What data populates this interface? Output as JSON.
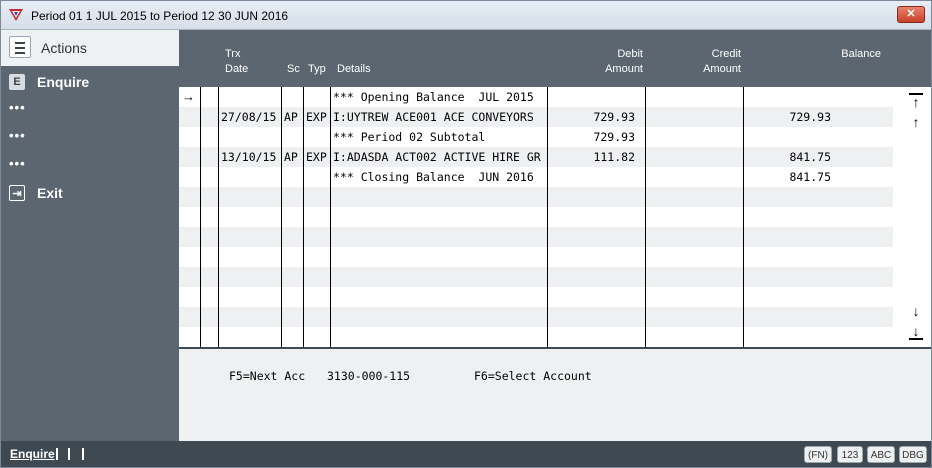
{
  "window": {
    "title": "Period 01 1 JUL 2015  to  Period 12 30 JUN 2016",
    "close_label": "✕"
  },
  "sidebar": {
    "header_label": "Actions",
    "items": [
      {
        "icon": "E",
        "label": "Enquire"
      },
      {
        "dots": "•••"
      },
      {
        "dots": "•••"
      },
      {
        "dots": "•••"
      },
      {
        "icon": "⇥",
        "label": "Exit"
      }
    ]
  },
  "grid": {
    "headers": {
      "trx_date_1": "Trx",
      "trx_date_2": "Date",
      "sc": "Sc",
      "typ": "Typ",
      "details": "Details",
      "debit_1": "Debit",
      "debit_2": "Amount",
      "credit_1": "Credit",
      "credit_2": "Amount",
      "balance": "Balance"
    },
    "pointer": "→",
    "rows": [
      {
        "date": "",
        "sc": "",
        "typ": "",
        "details": "*** Opening Balance  JUL 2015",
        "debit": "",
        "credit": "",
        "balance": ""
      },
      {
        "date": "27/08/15",
        "sc": "AP",
        "typ": "EXP",
        "details": "I:UYTREW ACE001 ACE CONVEYORS",
        "debit": "729.93",
        "credit": "",
        "balance": "729.93"
      },
      {
        "date": "",
        "sc": "",
        "typ": "",
        "details": "*** Period 02 Subtotal",
        "debit": "729.93",
        "credit": "",
        "balance": ""
      },
      {
        "date": "13/10/15",
        "sc": "AP",
        "typ": "EXP",
        "details": "I:ADASDA ACT002 ACTIVE HIRE GR",
        "debit": "111.82",
        "credit": "",
        "balance": "841.75"
      },
      {
        "date": "",
        "sc": "",
        "typ": "",
        "details": "*** Closing Balance  JUN 2016",
        "debit": "",
        "credit": "",
        "balance": "841.75"
      }
    ]
  },
  "footer": {
    "next_acc": "F5=Next Acc",
    "account": "3130-000-115",
    "select": "F6=Select Account"
  },
  "statusbar": {
    "mode": "Enquire",
    "badges": [
      "(FN)",
      "123",
      "ABC",
      "DBG"
    ]
  }
}
